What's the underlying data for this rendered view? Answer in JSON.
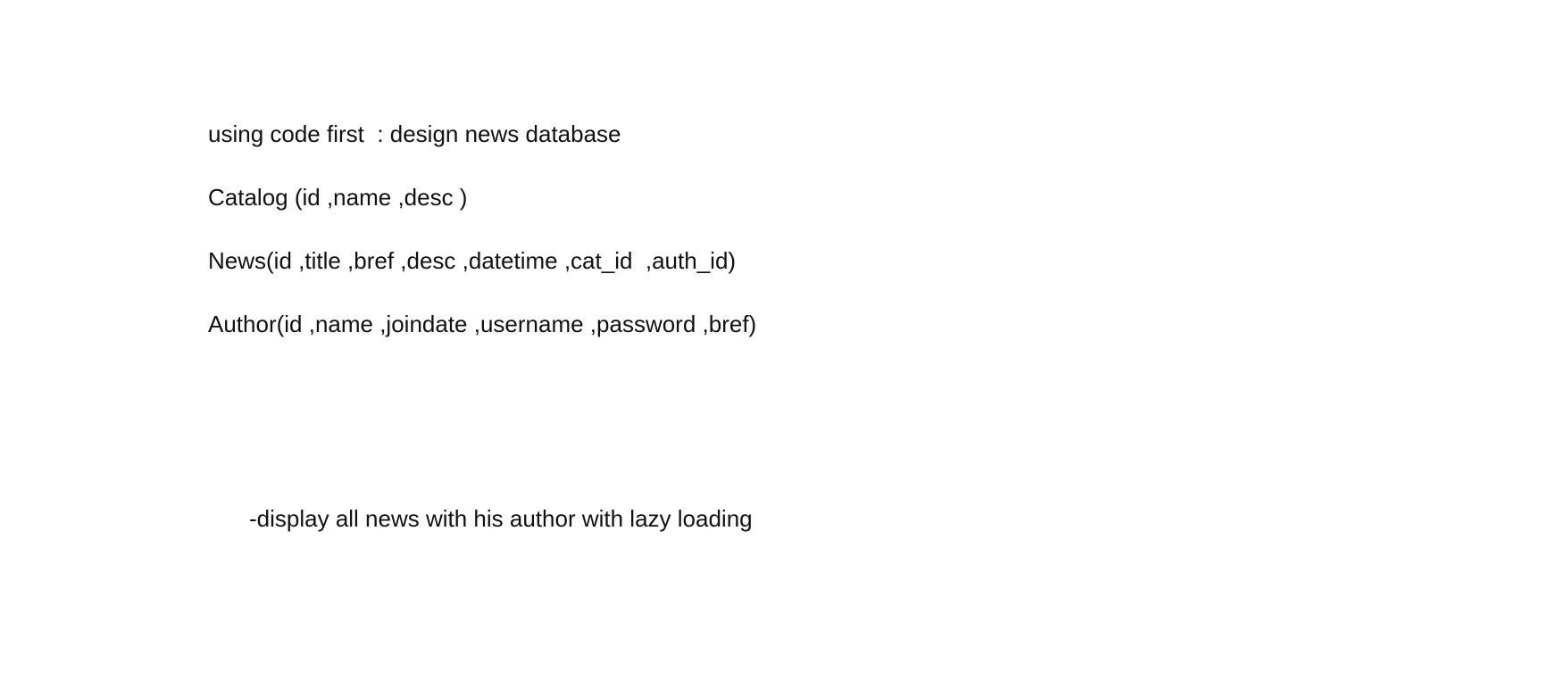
{
  "document": {
    "intro": "using code first  : design news database",
    "catalog": "Catalog (id ,name ,desc )",
    "news": "News(id ,title ,bref ,desc ,datetime ,cat_id  ,auth_id)",
    "author": "Author(id ,name ,joindate ,username ,password ,bref)",
    "task": "-display all news with his author with lazy loading"
  }
}
